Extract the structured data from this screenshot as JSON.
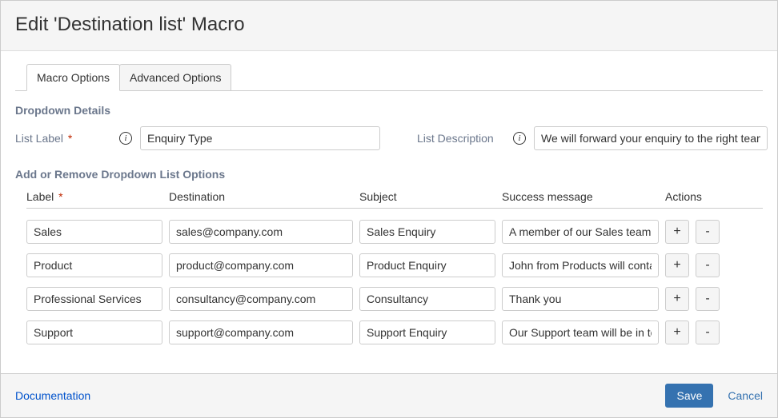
{
  "dialog": {
    "title": "Edit 'Destination list' Macro"
  },
  "tabs": {
    "macro_options": "Macro Options",
    "advanced_options": "Advanced Options"
  },
  "details": {
    "section_title": "Dropdown Details",
    "list_label_text": "List Label",
    "list_label_value": "Enquiry Type",
    "list_desc_text": "List Description",
    "list_desc_value": "We will forward your enquiry to the right team"
  },
  "options": {
    "section_title": "Add or Remove Dropdown List Options",
    "headers": {
      "label": "Label",
      "destination": "Destination",
      "subject": "Subject",
      "success": "Success message",
      "actions": "Actions"
    },
    "rows": [
      {
        "label": "Sales",
        "destination": "sales@company.com",
        "subject": "Sales Enquiry",
        "success": "A member of our Sales team will contact you"
      },
      {
        "label": "Product",
        "destination": "product@company.com",
        "subject": "Product Enquiry",
        "success": "John from Products will contact you"
      },
      {
        "label": "Professional Services",
        "destination": "consultancy@company.com",
        "subject": "Consultancy",
        "success": "Thank you"
      },
      {
        "label": "Support",
        "destination": "support@company.com",
        "subject": "Support Enquiry",
        "success": "Our Support team will be in touch"
      }
    ]
  },
  "footer": {
    "documentation": "Documentation",
    "save": "Save",
    "cancel": "Cancel"
  },
  "glyphs": {
    "plus": "+",
    "minus": "-",
    "info": "i",
    "asterisk": "*"
  }
}
